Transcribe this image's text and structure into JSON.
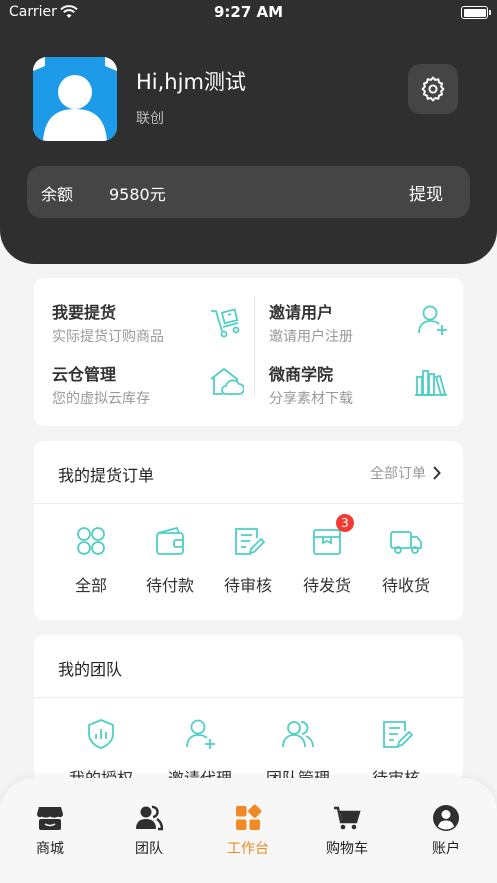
{
  "status_bar": {
    "carrier": "Carrier",
    "time": "9:27 AM",
    "battery_level": 1.0
  },
  "profile": {
    "greeting": "Hi,hjm测试",
    "organization": "联创",
    "balance_label": "余额",
    "balance_value": "9580元",
    "withdraw_label": "提现"
  },
  "quick_actions": [
    {
      "title": "我要提货",
      "subtitle": "实际提货订购商品",
      "icon": "hand-truck-icon"
    },
    {
      "title": "邀请用户",
      "subtitle": "邀请用户注册",
      "icon": "add-user-icon"
    },
    {
      "title": "云仓管理",
      "subtitle": "您的虚拟云库存",
      "icon": "cloud-warehouse-icon"
    },
    {
      "title": "微商学院",
      "subtitle": "分享素材下载",
      "icon": "books-icon"
    }
  ],
  "orders": {
    "title": "我的提货订单",
    "more_label": "全部订单",
    "items": [
      {
        "label": "全部",
        "icon": "grid-icon"
      },
      {
        "label": "待付款",
        "icon": "wallet-icon"
      },
      {
        "label": "待审核",
        "icon": "review-icon"
      },
      {
        "label": "待发货",
        "icon": "package-icon",
        "badge": "3"
      },
      {
        "label": "待收货",
        "icon": "truck-icon"
      }
    ]
  },
  "team": {
    "title": "我的团队",
    "items": [
      {
        "label": "我的授权",
        "icon": "shield-chart-icon"
      },
      {
        "label": "邀请代理",
        "icon": "add-user-icon"
      },
      {
        "label": "团队管理",
        "icon": "team-icon"
      },
      {
        "label": "待审核",
        "icon": "review-icon"
      }
    ]
  },
  "tabs": [
    {
      "label": "商城",
      "icon": "store-icon",
      "active": false
    },
    {
      "label": "团队",
      "icon": "team-icon",
      "active": false
    },
    {
      "label": "工作台",
      "icon": "workbench-icon",
      "active": true
    },
    {
      "label": "购物车",
      "icon": "cart-icon",
      "active": false
    },
    {
      "label": "账户",
      "icon": "account-icon",
      "active": false
    }
  ],
  "colors": {
    "accent_teal": "#4fcfc4",
    "header_bg": "#2f2f2f",
    "active_tab": "#f08a24",
    "badge": "#f03a32",
    "avatar_blue": "#1e9be8"
  }
}
